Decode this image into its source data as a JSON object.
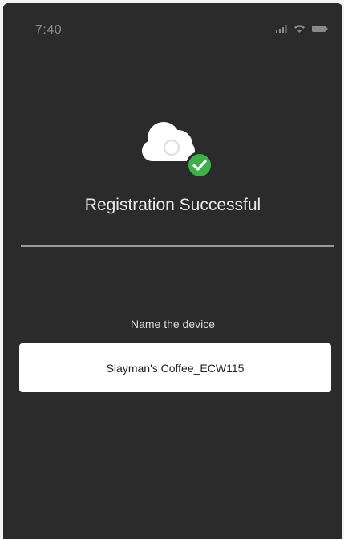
{
  "status_bar": {
    "time": "7:40"
  },
  "icons": {
    "cloud": "cloud-icon",
    "check": "checkmark-badge-icon",
    "signal": "signal-icon",
    "wifi": "wifi-icon",
    "battery": "battery-icon"
  },
  "colors": {
    "background": "#2b2b2b",
    "success_green": "#3db048",
    "divider": "#9a9a9a"
  },
  "main": {
    "title": "Registration Successful",
    "name_label": "Name the device",
    "device_name_value": "Slayman's Coffee_ECW115"
  }
}
